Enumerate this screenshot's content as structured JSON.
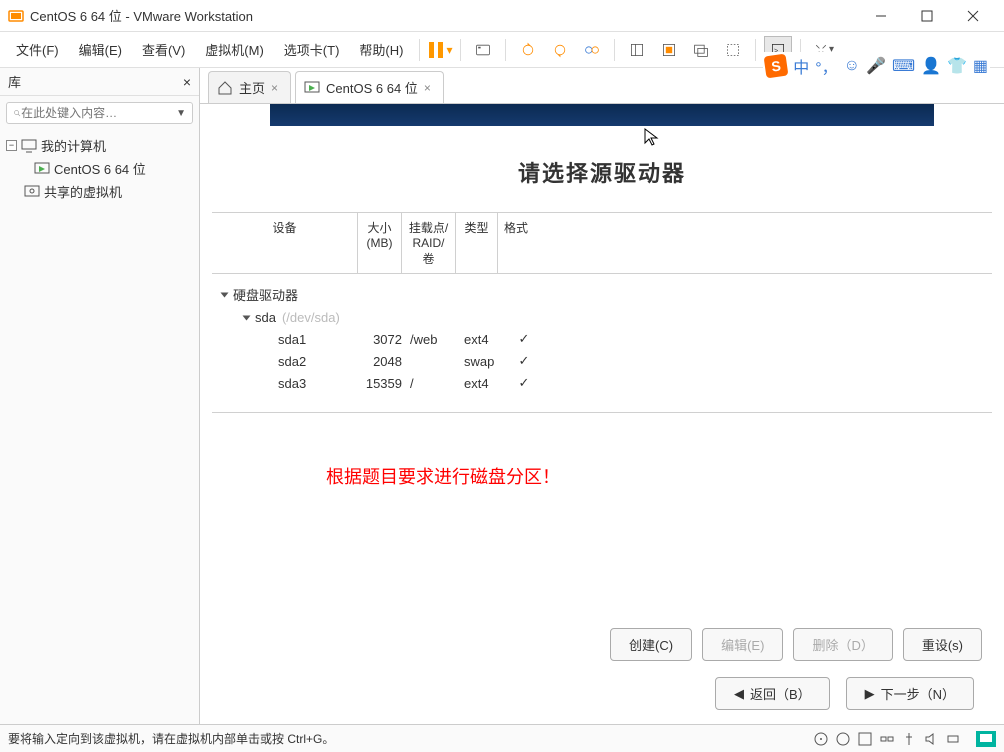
{
  "window": {
    "title": "CentOS 6 64 位 - VMware Workstation"
  },
  "menu": {
    "file": "文件(F)",
    "edit": "编辑(E)",
    "view": "查看(V)",
    "vm": "虚拟机(M)",
    "tabs": "选项卡(T)",
    "help": "帮助(H)"
  },
  "sidebar": {
    "title": "库",
    "search_placeholder": "在此处键入内容…",
    "node_mypc": "我的计算机",
    "node_vm": "CentOS 6 64 位",
    "node_shared": "共享的虚拟机"
  },
  "tabs": {
    "home": "主页",
    "vm": "CentOS 6 64 位"
  },
  "installer": {
    "title": "请选择源驱动器",
    "cols": {
      "device": "设备",
      "size": "大小\n(MB)",
      "mount": "挂载点/\nRAID/卷",
      "type": "类型",
      "format": "格式"
    },
    "group_hdd": "硬盘驱动器",
    "group_sda": "sda",
    "group_sda_hint": "(/dev/sda)",
    "rows": [
      {
        "dev": "sda1",
        "size": "3072",
        "mnt": "/web",
        "type": "ext4",
        "fmt": "✓"
      },
      {
        "dev": "sda2",
        "size": "2048",
        "mnt": "",
        "type": "swap",
        "fmt": "✓"
      },
      {
        "dev": "sda3",
        "size": "15359",
        "mnt": "/",
        "type": "ext4",
        "fmt": "✓"
      }
    ],
    "annotation": "根据题目要求进行磁盘分区！",
    "btn_create": "创建(C)",
    "btn_edit": "编辑(E)",
    "btn_delete": "删除（D）",
    "btn_reset": "重设(s)",
    "btn_back": "返回（B）",
    "btn_next": "下一步（N）"
  },
  "status": {
    "text": "要将输入定向到该虚拟机，请在虚拟机内部单击或按 Ctrl+G。"
  },
  "ime": {
    "lang": "中",
    "punct": "°，"
  }
}
